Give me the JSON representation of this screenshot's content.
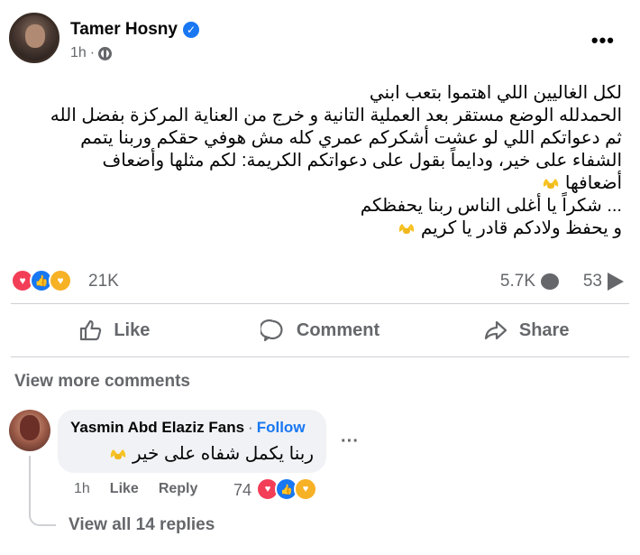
{
  "post": {
    "author": "Tamer Hosny",
    "verified_icon": "verified-badge-icon",
    "time": "1h",
    "audience_icon": "globe-icon",
    "lines": [
      "لكل الغاليين اللي اهتموا بتعب ابني",
      "الحمدلله الوضع مستقر بعد العملية التانية و خرج من العناية المركزة بفضل الله",
      "ثم دعواتكم اللي لو عشت أشكركم عمري كله مش هوفي حقكم وربنا يتمم",
      "الشفاء على خير، ودايماً بقول على دعواتكم الكريمة: لكم مثلها وأضعاف",
      "أضعافها",
      "... شكراً يا أغلى الناس ربنا يحفظكم",
      "و يحفظ ولادكم قادر يا كريم"
    ]
  },
  "stats": {
    "reaction_count": "21K",
    "comment_count": "5.7K",
    "share_count": "53"
  },
  "actions": {
    "like": "Like",
    "comment": "Comment",
    "share": "Share"
  },
  "view_more": "View more comments",
  "comment": {
    "author": "Yasmin Abd Elaziz Fans",
    "separator": "·",
    "follow": "Follow",
    "text": "ربنا يكمل شفاه على خير",
    "time": "1h",
    "like": "Like",
    "reply": "Reply",
    "reaction_count": "74",
    "more": "···"
  },
  "view_replies": "View all 14 replies",
  "colors": {
    "accent": "#1877f2",
    "secondary_text": "#65676b",
    "love": "#f33e58",
    "care": "#f7b125"
  }
}
